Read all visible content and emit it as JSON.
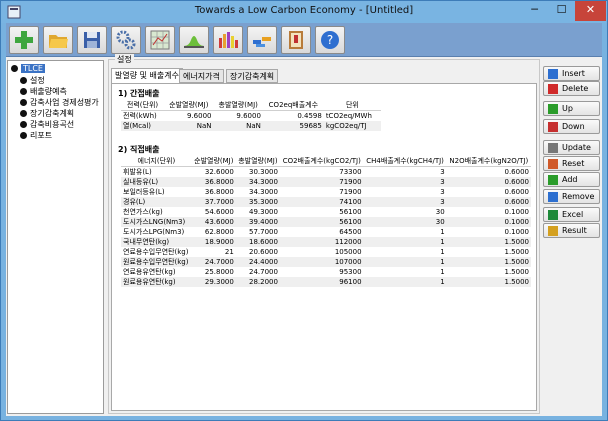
{
  "window": {
    "title": "Towards a Low Carbon Economy - [Untitled]",
    "minimize": "─",
    "maximize": "☐",
    "close": "✕"
  },
  "toolbar": [
    {
      "name": "new-button",
      "icon": "plus-icon"
    },
    {
      "name": "open-button",
      "icon": "folder-open-icon"
    },
    {
      "name": "save-button",
      "icon": "floppy-disk-icon"
    },
    {
      "name": "settings-button",
      "icon": "gears-icon"
    },
    {
      "name": "map-button",
      "icon": "map-grid-icon"
    },
    {
      "name": "distribution-chart-button",
      "icon": "bell-curve-icon"
    },
    {
      "name": "bar-chart-button",
      "icon": "bar-chart-icon"
    },
    {
      "name": "gradient-button",
      "icon": "gradient-bars-icon"
    },
    {
      "name": "report-button",
      "icon": "book-icon"
    },
    {
      "name": "help-button",
      "icon": "help-icon"
    }
  ],
  "tree": {
    "root": "TLCE",
    "items": [
      "설정",
      "배출량예측",
      "감축사업 경제성평가",
      "장기감축계획",
      "감축비용곡선",
      "리포트"
    ]
  },
  "group_label": "설정",
  "tabs": [
    "발열량 및 배출계수",
    "에너지가격",
    "장기감축계획"
  ],
  "indirect": {
    "title": "1) 간접배출",
    "headers": [
      "전력(단위)",
      "순발열량(MJ)",
      "총발열량(MJ)",
      "CO2eq배출계수",
      "단위"
    ],
    "rows": [
      [
        "전력(kWh)",
        "9.6000",
        "9.6000",
        "0.4598",
        "tCO2eq/MWh"
      ],
      [
        "열(Mcal)",
        "NaN",
        "NaN",
        "59685",
        "kgCO2eq/TJ"
      ]
    ]
  },
  "direct": {
    "title": "2) 직접배출",
    "headers": [
      "에너지(단위)",
      "순발열량(MJ)",
      "총발열량(MJ)",
      "CO2배출계수(kgCO2/TJ)",
      "CH4배출계수(kgCH4/TJ)",
      "N2O배출계수(kgN2O/TJ)"
    ],
    "rows": [
      [
        "휘발유(L)",
        "32.6000",
        "30.3000",
        "73300",
        "3",
        "0.6000"
      ],
      [
        "실내등유(L)",
        "36.8000",
        "34.3000",
        "71900",
        "3",
        "0.6000"
      ],
      [
        "보일러등유(L)",
        "36.8000",
        "34.3000",
        "71900",
        "3",
        "0.6000"
      ],
      [
        "경유(L)",
        "37.7000",
        "35.3000",
        "74100",
        "3",
        "0.6000"
      ],
      [
        "천연가스(kg)",
        "54.6000",
        "49.3000",
        "56100",
        "30",
        "0.1000"
      ],
      [
        "도시가스LNG(Nm3)",
        "43.6000",
        "39.4000",
        "56100",
        "30",
        "0.1000"
      ],
      [
        "도시가스LPG(Nm3)",
        "62.8000",
        "57.7000",
        "64500",
        "1",
        "0.1000"
      ],
      [
        "국내무연탄(kg)",
        "18.9000",
        "18.6000",
        "112000",
        "1",
        "1.5000"
      ],
      [
        "연료용수입무연탄(kg)",
        "21",
        "20.6000",
        "105000",
        "1",
        "1.5000"
      ],
      [
        "원료용수입무연탄(kg)",
        "24.7000",
        "24.4000",
        "107000",
        "1",
        "1.5000"
      ],
      [
        "연료용유연탄(kg)",
        "25.8000",
        "24.7000",
        "95300",
        "1",
        "1.5000"
      ],
      [
        "원료용유연탄(kg)",
        "29.3000",
        "28.2000",
        "96100",
        "1",
        "1.5000"
      ]
    ]
  },
  "side_buttons": [
    {
      "label": "Insert",
      "icon": "plus-icon",
      "color": "#2d6fd0"
    },
    {
      "label": "Delete",
      "icon": "x-icon",
      "color": "#d02a2a"
    },
    {
      "label": "Up",
      "icon": "arrow-up-icon",
      "color": "#2a9c2a"
    },
    {
      "label": "Down",
      "icon": "arrow-down-icon",
      "color": "#c63030"
    },
    {
      "label": "Update",
      "icon": "refresh-icon",
      "color": "#777777"
    },
    {
      "label": "Reset",
      "icon": "reset-icon",
      "color": "#d05a2a"
    },
    {
      "label": "Add",
      "icon": "add-icon",
      "color": "#2a9c2a"
    },
    {
      "label": "Remove",
      "icon": "remove-icon",
      "color": "#2d6fd0"
    },
    {
      "label": "Excel",
      "icon": "excel-icon",
      "color": "#1e8a3a"
    },
    {
      "label": "Result",
      "icon": "result-icon",
      "color": "#d4a020"
    }
  ]
}
